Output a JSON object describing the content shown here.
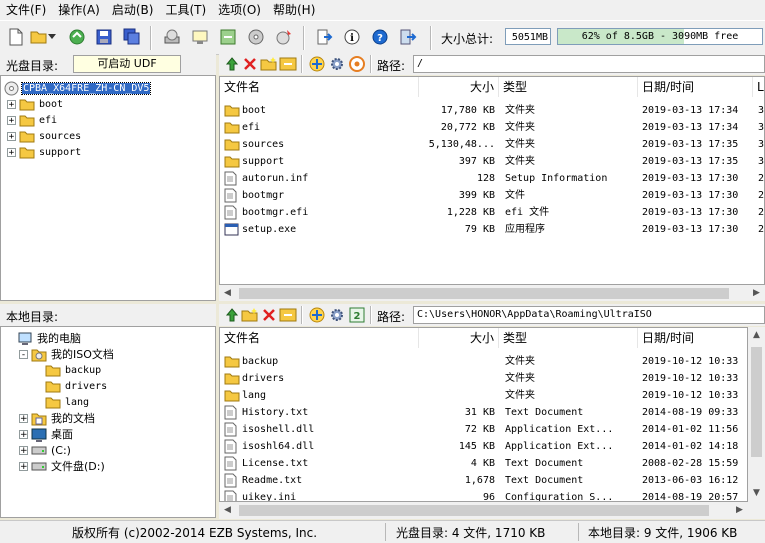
{
  "menu": [
    "文件(F)",
    "操作(A)",
    "启动(B)",
    "工具(T)",
    "选项(O)",
    "帮助(H)"
  ],
  "toolbar": {
    "size_label": "大小总计:",
    "size_value": "5051MB",
    "capacity_text": "62% of 8.5GB - 3090MB free",
    "capacity_percent": 62
  },
  "cd_panel": {
    "title": "光盘目录:",
    "boot_type": "可启动 UDF",
    "path_label": "路径:",
    "path": "/",
    "tree_root": "CPBA_X64FRE_ZH-CN_DV5",
    "tree_items": [
      "boot",
      "efi",
      "sources",
      "support"
    ],
    "columns": [
      "文件名",
      "大小",
      "类型",
      "日期/时间",
      "L"
    ],
    "rows": [
      {
        "name": "boot",
        "size": "17,780 KB",
        "type": "文件夹",
        "date": "2019-03-13 17:34",
        "extra": "3",
        "icon": "folder"
      },
      {
        "name": "efi",
        "size": "20,772 KB",
        "type": "文件夹",
        "date": "2019-03-13 17:34",
        "extra": "3",
        "icon": "folder"
      },
      {
        "name": "sources",
        "size": "5,130,48...",
        "type": "文件夹",
        "date": "2019-03-13 17:35",
        "extra": "3",
        "icon": "folder"
      },
      {
        "name": "support",
        "size": "397 KB",
        "type": "文件夹",
        "date": "2019-03-13 17:35",
        "extra": "3",
        "icon": "folder"
      },
      {
        "name": "autorun.inf",
        "size": "128",
        "type": "Setup Information",
        "date": "2019-03-13 17:30",
        "extra": "2",
        "icon": "file"
      },
      {
        "name": "bootmgr",
        "size": "399 KB",
        "type": "文件",
        "date": "2019-03-13 17:30",
        "extra": "2",
        "icon": "file"
      },
      {
        "name": "bootmgr.efi",
        "size": "1,228 KB",
        "type": "efi 文件",
        "date": "2019-03-13 17:30",
        "extra": "2",
        "icon": "file"
      },
      {
        "name": "setup.exe",
        "size": "79 KB",
        "type": "应用程序",
        "date": "2019-03-13 17:30",
        "extra": "2",
        "icon": "app"
      }
    ]
  },
  "local_panel": {
    "title": "本地目录:",
    "path_label": "路径:",
    "path": "C:\\Users\\HONOR\\AppData\\Roaming\\UltraISO",
    "tree": [
      {
        "label": "我的电脑",
        "level": 0,
        "icon": "computer",
        "expander": ""
      },
      {
        "label": "我的ISO文档",
        "level": 1,
        "icon": "iso",
        "expander": "-"
      },
      {
        "label": "backup",
        "level": 2,
        "icon": "folder",
        "expander": ""
      },
      {
        "label": "drivers",
        "level": 2,
        "icon": "folder",
        "expander": ""
      },
      {
        "label": "lang",
        "level": 2,
        "icon": "folder",
        "expander": ""
      },
      {
        "label": "我的文档",
        "level": 1,
        "icon": "docs",
        "expander": "+"
      },
      {
        "label": "桌面",
        "level": 1,
        "icon": "desktop",
        "expander": "+"
      },
      {
        "label": "(C:)",
        "level": 1,
        "icon": "drive",
        "expander": "+"
      },
      {
        "label": "文件盘(D:)",
        "level": 1,
        "icon": "drive",
        "expander": "+"
      }
    ],
    "columns": [
      "文件名",
      "大小",
      "类型",
      "日期/时间"
    ],
    "rows": [
      {
        "name": "backup",
        "size": "",
        "type": "文件夹",
        "date": "2019-10-12 10:33",
        "icon": "folder"
      },
      {
        "name": "drivers",
        "size": "",
        "type": "文件夹",
        "date": "2019-10-12 10:33",
        "icon": "folder"
      },
      {
        "name": "lang",
        "size": "",
        "type": "文件夹",
        "date": "2019-10-12 10:33",
        "icon": "folder"
      },
      {
        "name": "History.txt",
        "size": "31 KB",
        "type": "Text Document",
        "date": "2014-08-19 09:33",
        "icon": "file"
      },
      {
        "name": "isoshell.dll",
        "size": "72 KB",
        "type": "Application Ext...",
        "date": "2014-01-02 11:56",
        "icon": "file"
      },
      {
        "name": "isoshl64.dll",
        "size": "145 KB",
        "type": "Application Ext...",
        "date": "2014-01-02 14:18",
        "icon": "file"
      },
      {
        "name": "License.txt",
        "size": "4 KB",
        "type": "Text Document",
        "date": "2008-02-28 15:59",
        "icon": "file"
      },
      {
        "name": "Readme.txt",
        "size": "1,678",
        "type": "Text Document",
        "date": "2013-06-03 16:12",
        "icon": "file"
      },
      {
        "name": "uikey.ini",
        "size": "96",
        "type": "Configuration S...",
        "date": "2014-08-19 20:57",
        "icon": "file"
      }
    ]
  },
  "status": {
    "copyright": "版权所有 (c)2002-2014 EZB Systems, Inc.",
    "cd_summary": "光盘目录: 4 文件, 1710 KB",
    "local_summary": "本地目录: 9 文件, 1906 KB"
  }
}
